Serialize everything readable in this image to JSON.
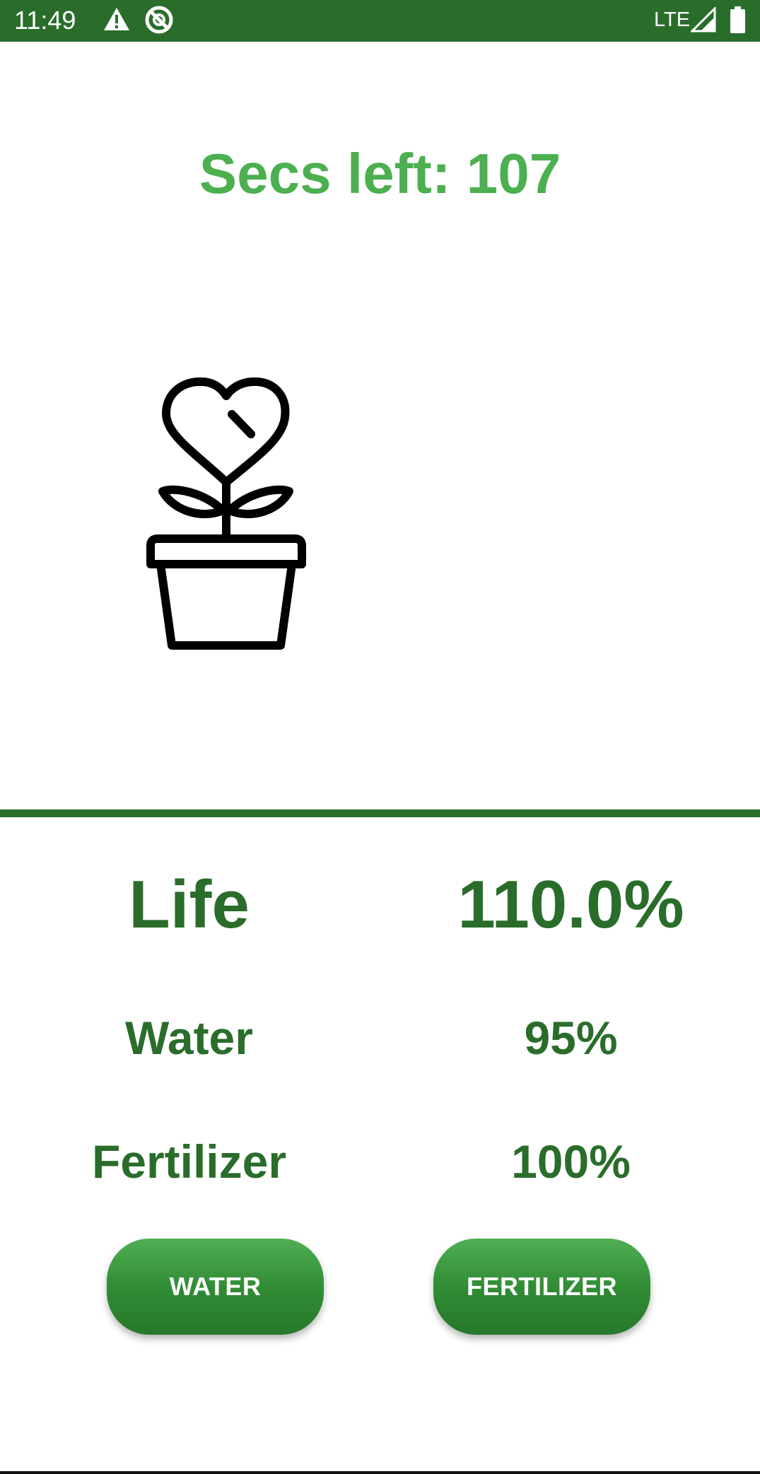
{
  "status_bar": {
    "time": "11:49",
    "network": "LTE",
    "icons": [
      "warning-icon",
      "no-sync-icon",
      "signal-icon",
      "battery-icon"
    ],
    "background_color": "#2a6d2b"
  },
  "timer": {
    "text": "Secs left: 107",
    "color": "#4caf50"
  },
  "plant": {
    "icon": "potted-heart-plant-icon"
  },
  "stats": {
    "life": {
      "label": "Life",
      "value": "110.0%"
    },
    "water": {
      "label": "Water",
      "value": "95%"
    },
    "fertilizer": {
      "label": "Fertilizer",
      "value": "100%"
    },
    "text_color": "#2a6d2b"
  },
  "buttons": {
    "water_label": "WATER",
    "fertilizer_label": "FERTILIZER",
    "color": "#2f8a33"
  }
}
